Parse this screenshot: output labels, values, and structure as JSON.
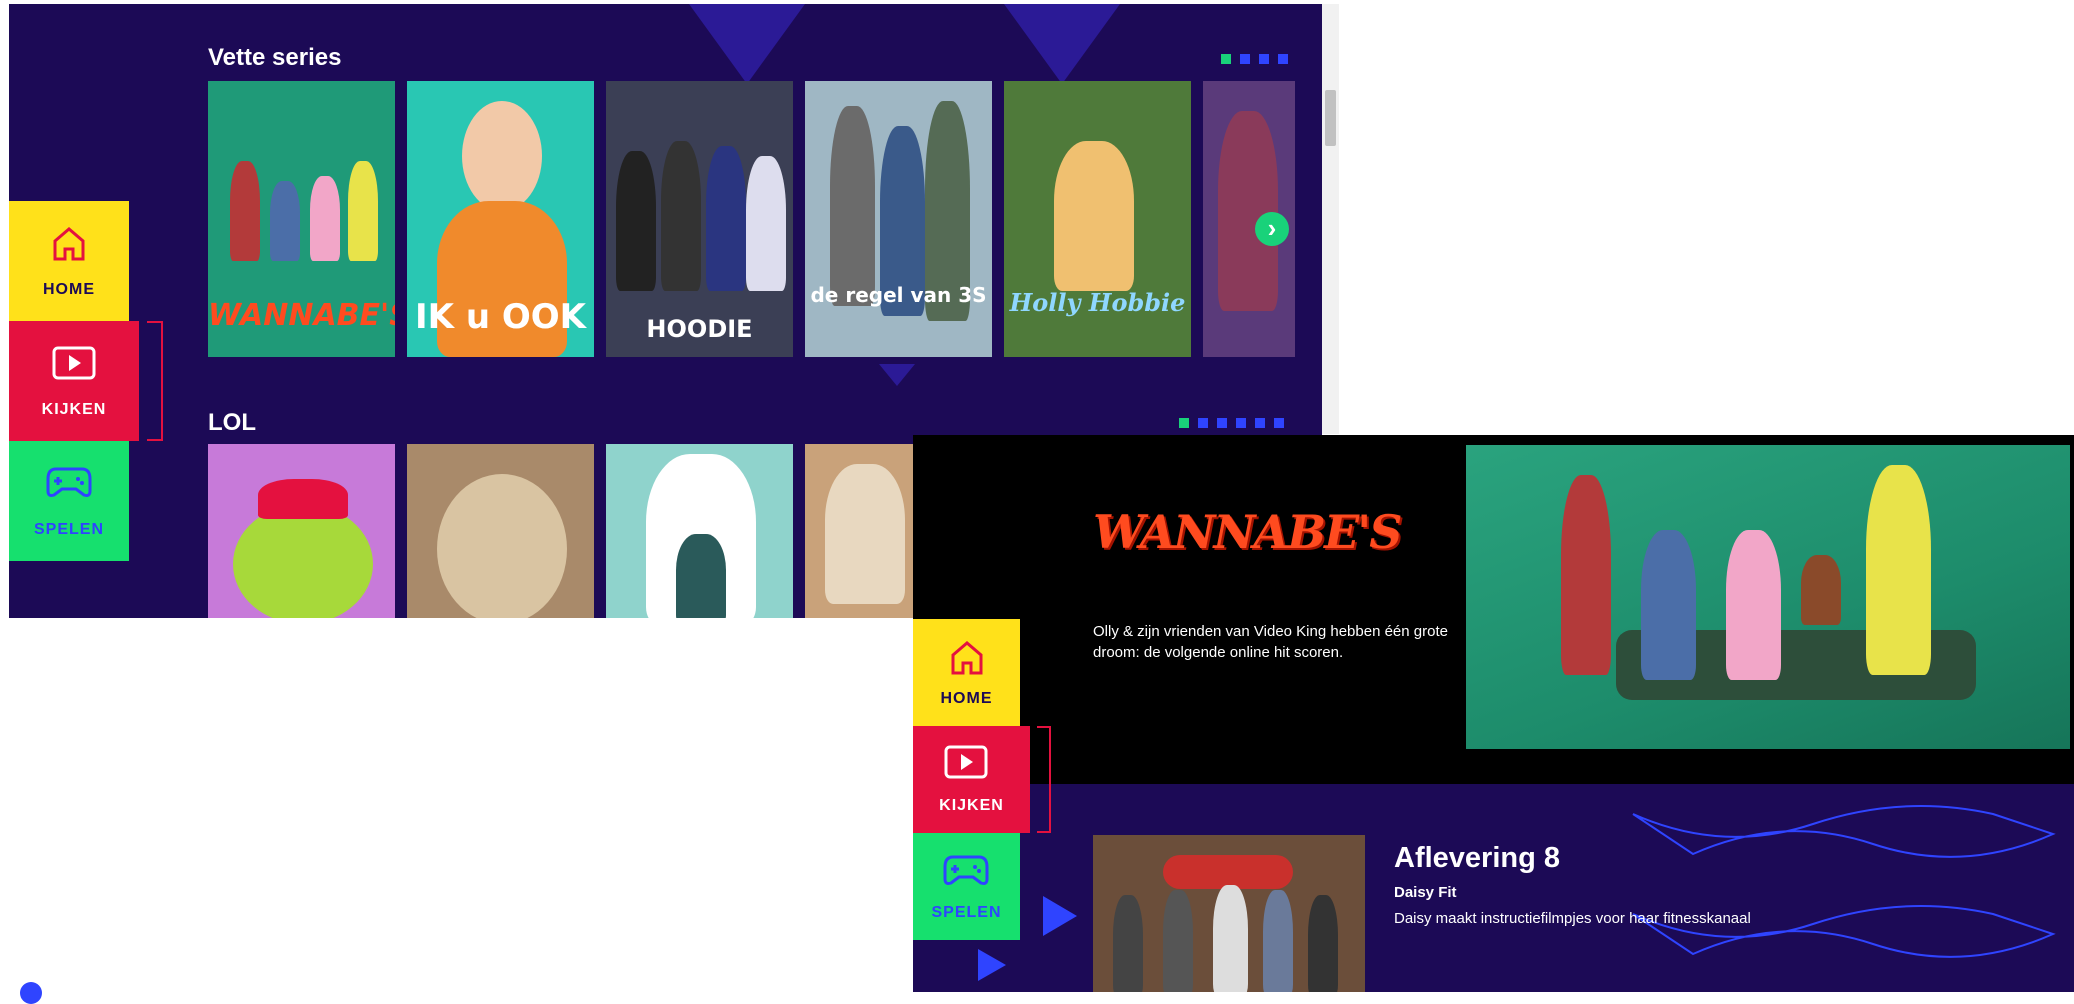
{
  "shot1": {
    "rows": [
      {
        "title": "Vette series",
        "dot_count": 4,
        "tiles": [
          {
            "label": "WANNABE'S",
            "bg": "#1f9a78",
            "label_color": "#ff4b1f"
          },
          {
            "label": "IK u OOK",
            "bg": "#29c7b3",
            "label_color": "#ffffff"
          },
          {
            "label": "HOODIE",
            "bg": "#3b3f55",
            "label_color": "#ffffff"
          },
          {
            "label": "de regel van 3S",
            "bg": "#9fb7c4",
            "label_color": "#ffffff"
          },
          {
            "label": "Holly Hobbie",
            "bg": "#4f7a3a",
            "label_color": "#8fd7ff"
          },
          {
            "label": "",
            "bg": "#5a3a7a",
            "label_color": "#ffffff"
          }
        ]
      },
      {
        "title": "LOL",
        "dot_count": 6,
        "tiles": [
          {
            "label": "",
            "bg": "#c77ad9"
          },
          {
            "label": "",
            "bg": "#a98a6a"
          },
          {
            "label": "",
            "bg": "#8fd3cc"
          },
          {
            "label": "",
            "bg": "#c9a27a"
          }
        ]
      }
    ],
    "nav": {
      "home": "HOME",
      "kijken": "KIJKEN",
      "spelen": "SPELEN"
    }
  },
  "shot2": {
    "show_logo": "WANNABE'S",
    "description": "Olly & zijn vrienden van Video King hebben één grote droom: de volgende online hit scoren.",
    "episode": {
      "title": "Aflevering 8",
      "subtitle": "Daisy Fit",
      "description": "Daisy maakt instructiefilmpjes voor haar fitnesskanaal"
    },
    "nav": {
      "home": "HOME",
      "kijken": "KIJKEN",
      "spelen": "SPELEN"
    }
  },
  "colors": {
    "background": "#1c0a56",
    "home": "#ffe11a",
    "kijken": "#e4113f",
    "spelen": "#16e06e",
    "accent_blue": "#2f44ff",
    "accent_green": "#19d27a"
  }
}
